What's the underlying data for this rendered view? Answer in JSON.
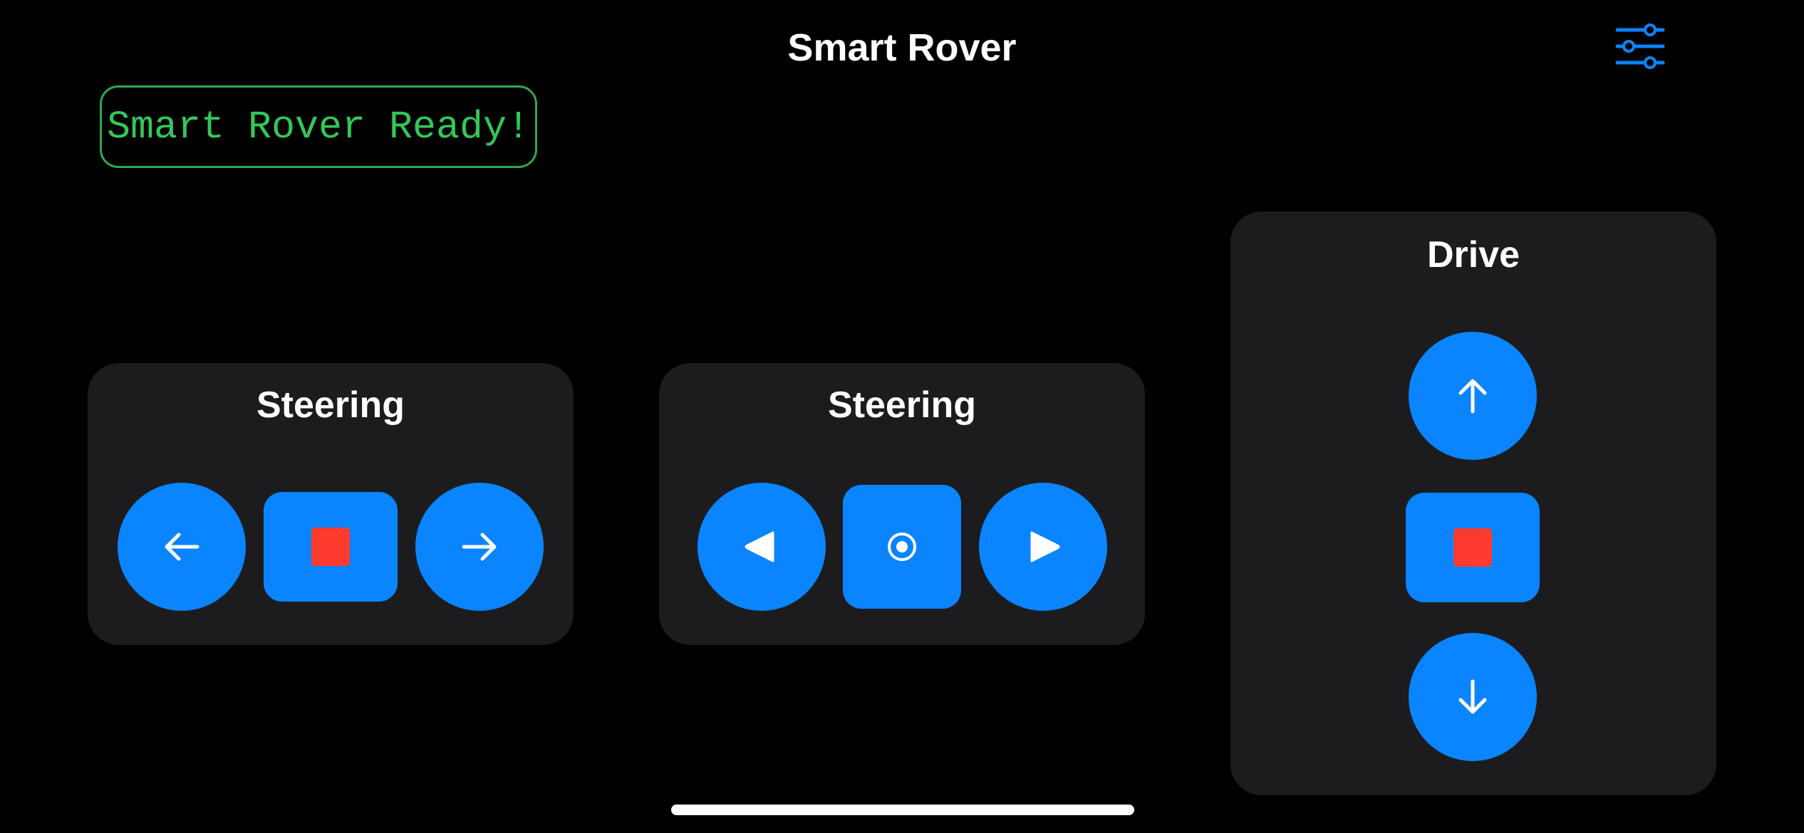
{
  "app": {
    "title": "Smart Rover"
  },
  "status": {
    "message": "Smart Rover Ready!"
  },
  "panels": {
    "steering_arrows": {
      "title": "Steering",
      "buttons": [
        "arrow-left-icon",
        "stop-square-icon",
        "arrow-right-icon"
      ]
    },
    "steering_triangles": {
      "title": "Steering",
      "buttons": [
        "triangle-left-icon",
        "center-dot-icon",
        "triangle-right-icon"
      ]
    },
    "drive": {
      "title": "Drive",
      "buttons": [
        "arrow-up-icon",
        "stop-square-icon",
        "arrow-down-icon"
      ]
    }
  },
  "icons": {
    "settings": "sliders-icon"
  },
  "colors": {
    "background": "#000000",
    "panel": "#1c1c1e",
    "accent_blue": "#0a84ff",
    "stop_red": "#ff3b30",
    "status_green": "#34c759",
    "status_border": "#2fa84f"
  }
}
